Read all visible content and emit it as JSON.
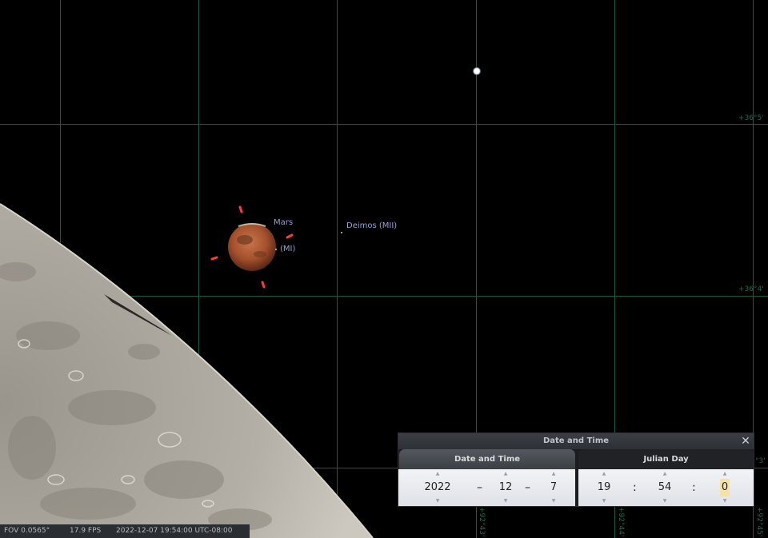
{
  "sky": {
    "grid_labels": {
      "dec_top": "+36°5'",
      "dec_mid": "+36°4'",
      "dec_low": "°3'",
      "ra_1": "+92°43'",
      "ra_2": "+92°44'",
      "ra_3": "+92°45'"
    },
    "objects": {
      "mars_label": "Mars",
      "phobos_label": "(MI)",
      "deimos_label": "Deimos (MII)"
    },
    "colors": {
      "grid": "#1d5a47",
      "label": "#9aa0d6",
      "marker": "#ff3b3b"
    }
  },
  "dialog": {
    "title": "Date and Time",
    "close_icon": "close-icon",
    "tabs": [
      "Date and Time",
      "Julian Day"
    ],
    "date": {
      "year": "2022",
      "month": "12",
      "day": "7",
      "separator": "–"
    },
    "time": {
      "hour": "19",
      "minute": "54",
      "second": "0",
      "separator": ":"
    },
    "arrow_up": "▲",
    "arrow_down": "▼"
  },
  "status_bar": {
    "fov": "FOV 0.0565°",
    "fps": "17.9 FPS",
    "datetime": "2022-12-07 19:54:00 UTC-08:00"
  }
}
